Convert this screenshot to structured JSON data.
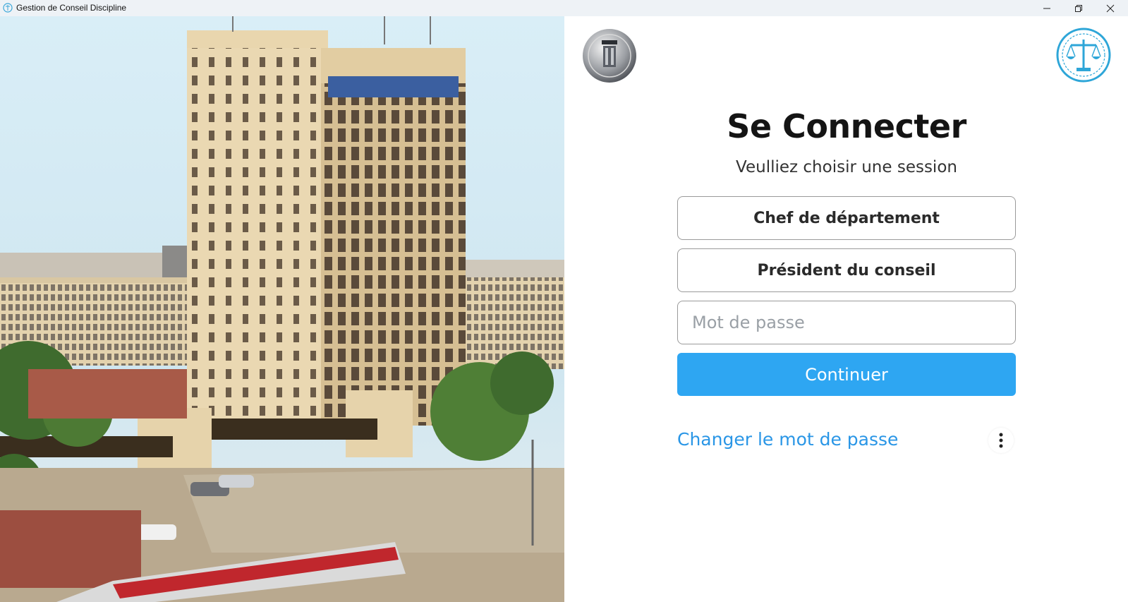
{
  "window": {
    "title": "Gestion de Conseil Discipline",
    "controls": [
      "minimize",
      "maximize",
      "close"
    ]
  },
  "login": {
    "heading": "Se Connecter",
    "subheading": "Veulliez choisir une session",
    "sessions": [
      {
        "label": "Chef de département"
      },
      {
        "label": "Président du conseil"
      }
    ],
    "password": {
      "placeholder": "Mot de passe",
      "value": ""
    },
    "continue_label": "Continuer",
    "change_password_label": "Changer le mot de passe"
  },
  "colors": {
    "accent": "#2ea6f2",
    "link": "#2a96e6",
    "heading": "#141414",
    "border": "#9a9a9a"
  },
  "icons": {
    "app": "scales-icon",
    "logo_left": "university-seal-icon",
    "logo_right": "justice-scales-laurel-icon",
    "more": "more-vertical-icon"
  }
}
